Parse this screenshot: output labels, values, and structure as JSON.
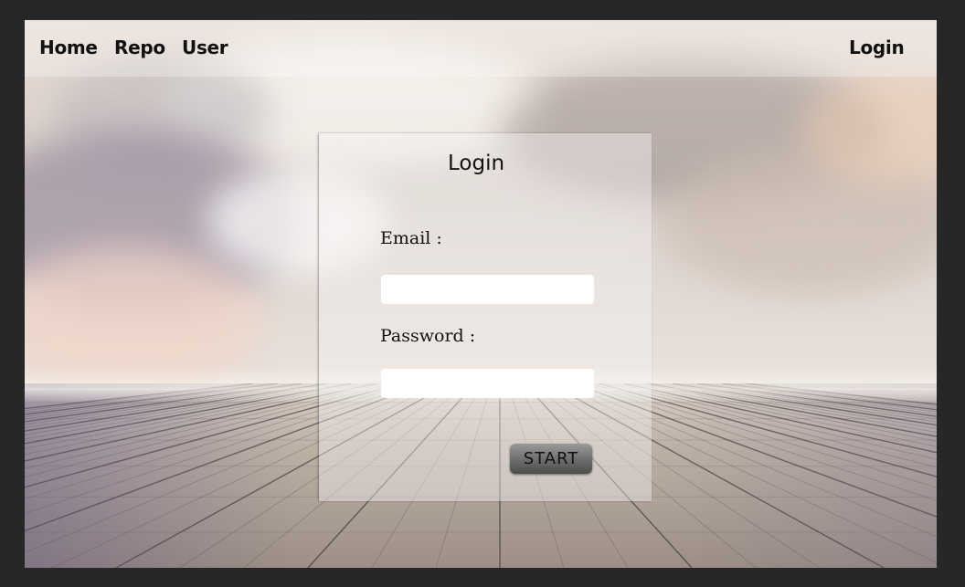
{
  "navbar": {
    "links": [
      {
        "label": "Home"
      },
      {
        "label": "Repo"
      },
      {
        "label": "User"
      }
    ],
    "login_label": "Login"
  },
  "login_form": {
    "title": "Login",
    "email_label": "Email :",
    "email_value": "",
    "password_label": "Password :",
    "password_value": "",
    "submit_label": "START"
  },
  "background": {
    "scene": "cloudy sky over wooden deck",
    "colors": {
      "sky": "#ddd4cc",
      "deck": "#a89a8f",
      "frame": "#272727"
    }
  }
}
